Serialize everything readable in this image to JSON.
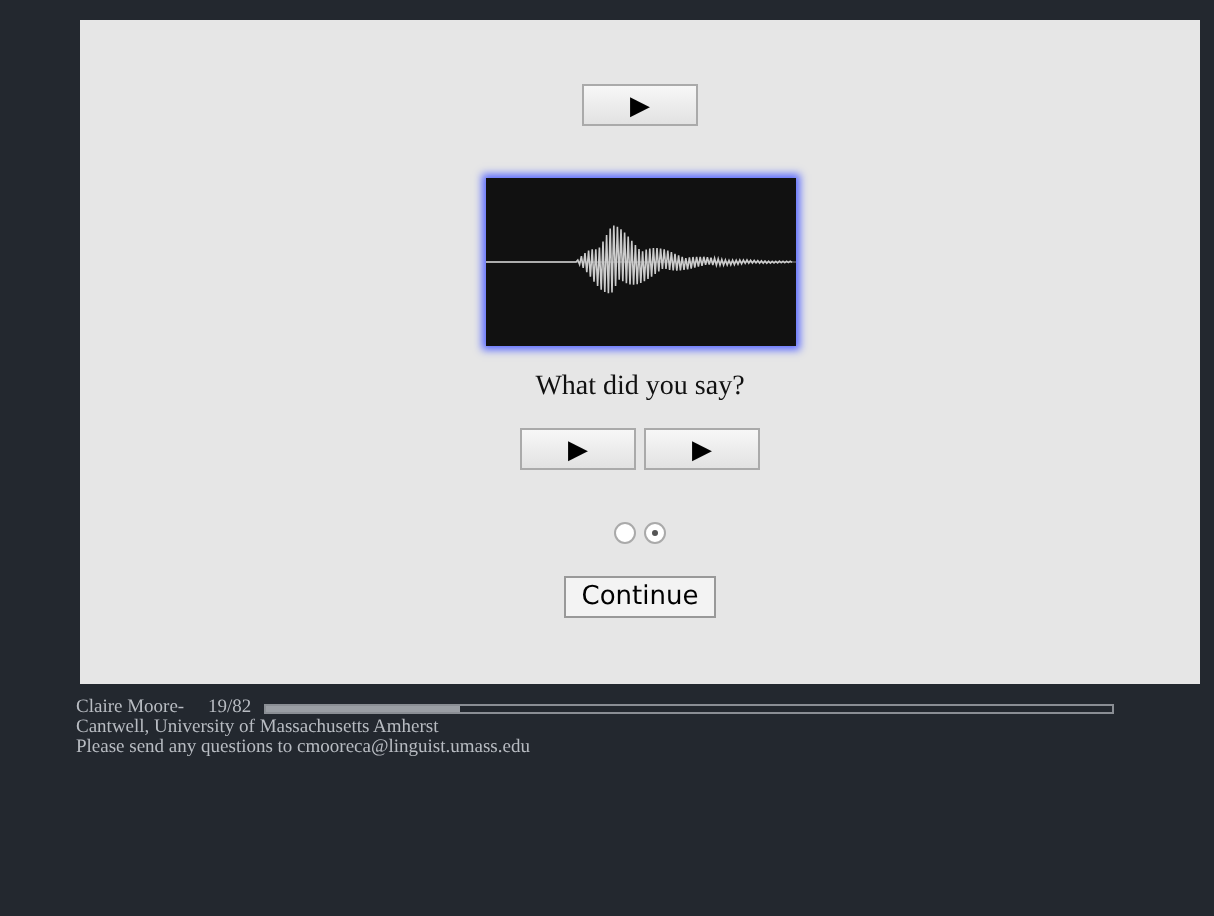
{
  "top_play_button": {
    "label": "▶"
  },
  "prompt": "What did you say?",
  "answer_buttons": [
    {
      "label": "▶"
    },
    {
      "label": "▶"
    }
  ],
  "choices": [
    {
      "selected": false
    },
    {
      "selected": true
    }
  ],
  "continue_button": {
    "label": "Continue"
  },
  "footer": {
    "author_line_1": "Claire Moore-",
    "counter": "19/82",
    "progress": {
      "level": 0.23
    },
    "author_line_2": "Cantwell, University of Massachusetts Amherst",
    "contact": "Please send any questions to cmooreca@linguist.umass.edu"
  }
}
